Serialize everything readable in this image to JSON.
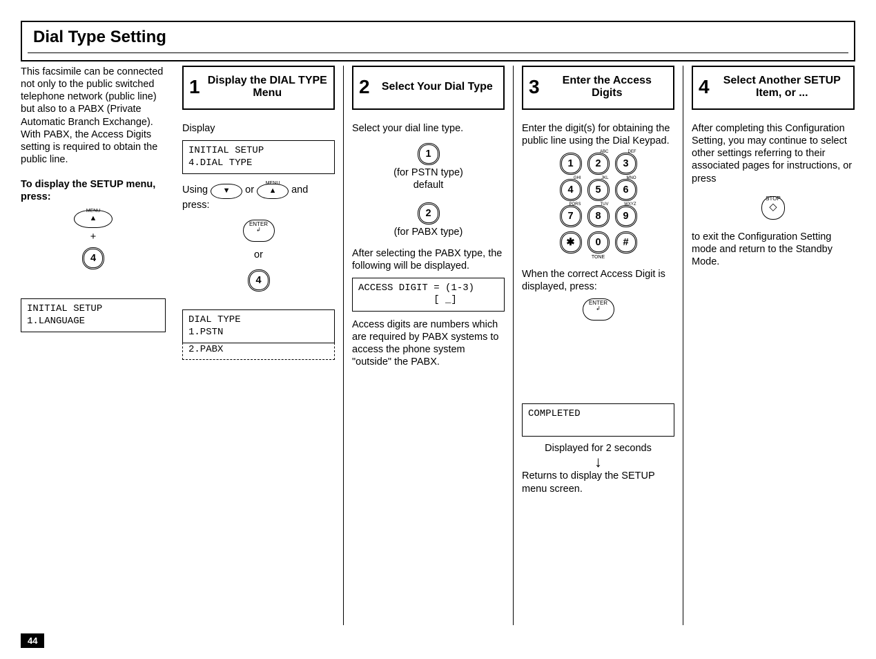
{
  "page_number": "44",
  "heading": "Dial Type Setting",
  "intro": {
    "p1": "This facsimile can be connected not only to the public switched telephone network (public line) but also to a PABX (Private Automatic Branch Exchange). With PABX, the Access Digits setting is required to obtain the public line.",
    "p2_bold": "To display the SETUP menu, press:",
    "plus": "+",
    "key4": "4",
    "menu_label": "MENU",
    "lcd": "INITIAL SETUP\n1.LANGUAGE"
  },
  "step1": {
    "num": "1",
    "title": "Display the DIAL TYPE Menu",
    "p_display": "Display",
    "lcd1": "INITIAL SETUP\n4.DIAL TYPE",
    "using": "Using",
    "or": "or",
    "and": "and",
    "press": "press:",
    "or2": "or",
    "key4": "4",
    "menu_label": "MENU",
    "enter_label": "ENTER\n↲",
    "lcd2_l1": "DIAL TYPE",
    "lcd2_l2": "1.PSTN",
    "lcd2_dashed": "2.PABX"
  },
  "step2": {
    "num": "2",
    "title": "Select Your Dial Type",
    "p1": "Select your dial line type.",
    "key1": "1",
    "l1a": "(for PSTN type)",
    "l1b": "default",
    "key2": "2",
    "l2a": "(for PABX type)",
    "p2": "After selecting the PABX type, the following will be displayed.",
    "lcd": "ACCESS DIGIT = (1-3)\n             [ _]",
    "p3": "Access digits are numbers which are required by PABX systems to access the phone system \"outside\" the PABX."
  },
  "step3": {
    "num": "3",
    "title": "Enter the Access Digits",
    "p1": "Enter the digit(s) for obtaining the public line using the Dial Keypad.",
    "keys": [
      "1",
      "2",
      "3",
      "4",
      "5",
      "6",
      "7",
      "8",
      "9",
      "✱",
      "0",
      "#"
    ],
    "sups": [
      "",
      "ABC",
      "DEF",
      "GHI",
      "JKL",
      "MNO",
      "PQRS",
      "TUV",
      "WXYZ",
      "",
      "",
      ""
    ],
    "tone": "TONE",
    "p2": "When the correct Access Digit is displayed, press:",
    "enter_label": "ENTER\n↲",
    "lcd_completed": "COMPLETED",
    "p3": "Displayed for 2 seconds",
    "p4": "Returns to display the SETUP menu screen."
  },
  "step4": {
    "num": "4",
    "title": "Select Another SETUP Item, or ...",
    "p1": "After completing this Configuration Setting, you may continue to select other settings referring to their associated pages for instructions, or press",
    "stop_label": "STOP",
    "p2": "to exit the Configuration Setting mode and return to the Standby Mode."
  }
}
